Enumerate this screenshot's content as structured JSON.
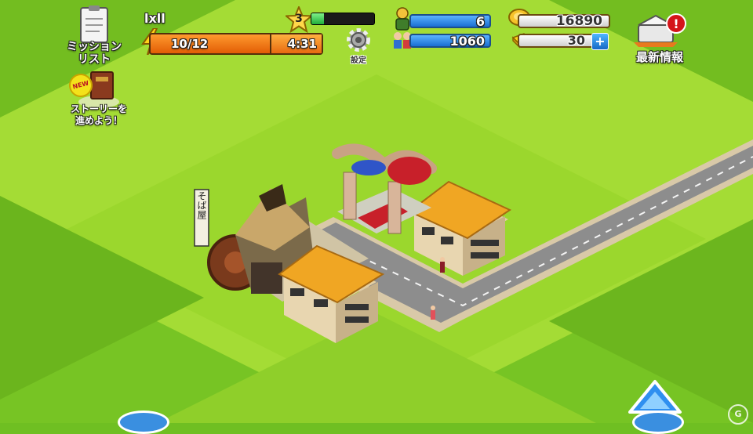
{
  "hud": {
    "mission_label_line1": "ミッション",
    "mission_label_line2": "リスト",
    "story_label_line1": "ストーリーを",
    "story_label_line2": "進めよう！",
    "new_badge": "NEW",
    "player_name": "lxll",
    "player_level": "3",
    "exp_fraction": 0.2,
    "stamina": "10/12",
    "stamina_timer": "4:31",
    "settings_label": "設定",
    "population": "6",
    "workers": "1060",
    "coins": "16890",
    "gold": "30",
    "gold_add": "+",
    "news_label": "最新情報",
    "news_alert": "!"
  },
  "scene": {
    "shop_banner": "そば屋",
    "watermark": "G"
  },
  "colors": {
    "grass_light": "#9fdd2f",
    "grass_dark": "#6fbf22",
    "road": "#8e8e8e",
    "roof": "#f0a623",
    "stamina": "#f27a12",
    "resource_blue": "#1a6fd3"
  }
}
